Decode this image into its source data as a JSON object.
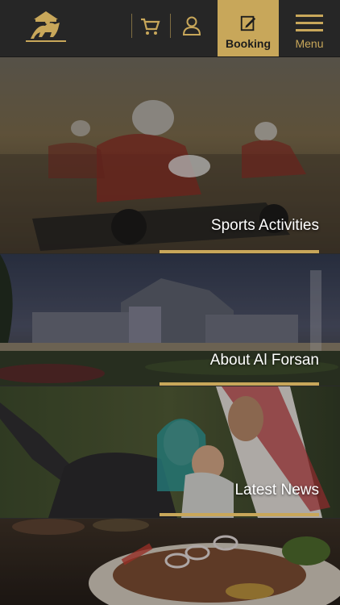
{
  "header": {
    "booking_label": "Booking",
    "menu_label": "Menu",
    "icons": [
      "horse-rider-logo",
      "cart-icon",
      "user-icon",
      "edit-icon",
      "hamburger-icon"
    ]
  },
  "colors": {
    "gold": "#c8a75a",
    "header_bg": "#262626",
    "text": "#ffffff"
  },
  "panels": [
    {
      "label": "Sports Activities"
    },
    {
      "label": "About Al Forsan"
    },
    {
      "label": "Latest News"
    },
    {
      "label": ""
    }
  ]
}
